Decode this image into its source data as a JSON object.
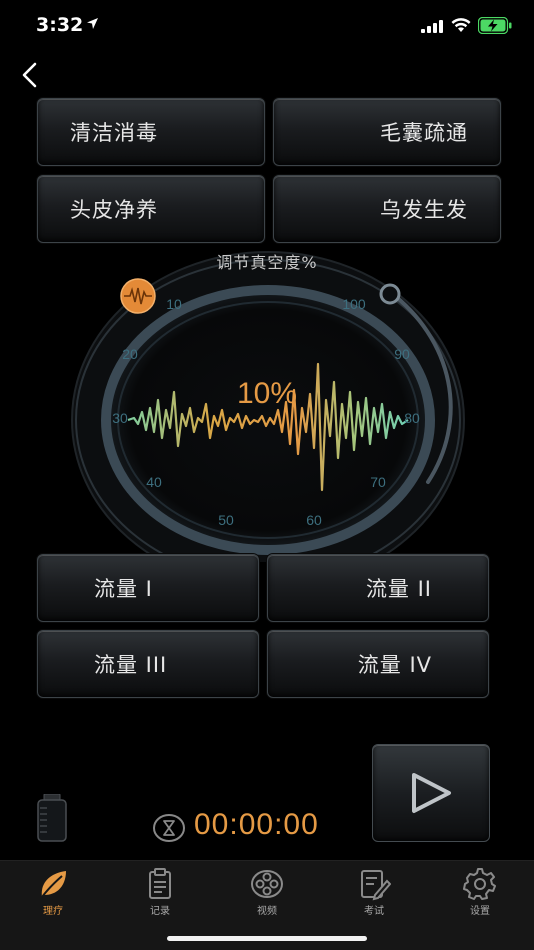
{
  "status_bar": {
    "time": "3:32"
  },
  "mode_buttons": [
    "清洁消毒",
    "毛囊疏通",
    "头皮净养",
    "乌发生发"
  ],
  "dial": {
    "title": "调节真空度%",
    "value_label": "10%",
    "ticks": [
      "10",
      "20",
      "30",
      "40",
      "50",
      "60",
      "70",
      "80",
      "90",
      "100"
    ]
  },
  "flow_buttons": [
    "流量 I",
    "流量 II",
    "流量 III",
    "流量 IV"
  ],
  "timer": "00:00:00",
  "tabs": [
    {
      "label": "理疗",
      "icon": "leaf-icon",
      "active": true
    },
    {
      "label": "记录",
      "icon": "clipboard-icon",
      "active": false
    },
    {
      "label": "视频",
      "icon": "film-reel-icon",
      "active": false
    },
    {
      "label": "考试",
      "icon": "exam-pen-icon",
      "active": false
    },
    {
      "label": "设置",
      "icon": "gear-icon",
      "active": false
    }
  ],
  "colors": {
    "accent": "#e59a45",
    "dial_ring": "#3b4a55",
    "wave_green": "#7fcfa0"
  }
}
